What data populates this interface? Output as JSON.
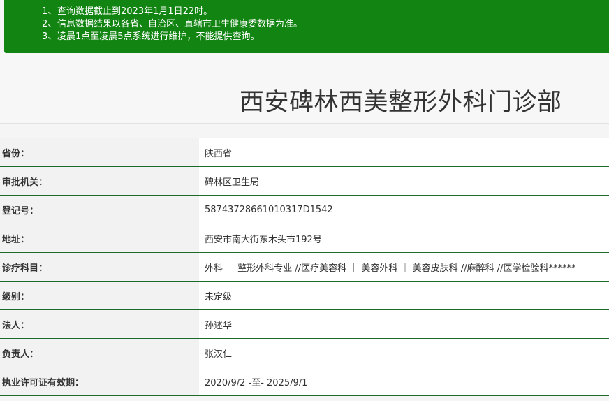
{
  "notice": {
    "lines": [
      {
        "num": "1、",
        "text": "查询数据截止到2023年1月1日22时。"
      },
      {
        "num": "2、",
        "text": "信息数据结果以各省、自治区、直辖市卫生健康委数据为准。"
      },
      {
        "num": "3、",
        "text": "凌晨1点至凌晨5点系统进行维护，不能提供查询。"
      }
    ]
  },
  "page": {
    "title": "西安碑林西美整形外科门诊部"
  },
  "info": {
    "rows": [
      {
        "label": "省份：",
        "value": "陕西省"
      },
      {
        "label": "审批机关：",
        "value": "碑林区卫生局"
      },
      {
        "label": "登记号：",
        "value": "58743728661010317D1542"
      },
      {
        "label": "地址：",
        "value": "西安市南大街东木头市192号"
      },
      {
        "label": "诊疗科目：",
        "value": "外科 ｜ 整形外科专业 //医疗美容科 ｜ 美容外科 ｜ 美容皮肤科 //麻醉科 //医学检验科******"
      },
      {
        "label": "级别：",
        "value": "未定级"
      },
      {
        "label": "法人：",
        "value": "孙述华"
      },
      {
        "label": "负责人：",
        "value": "张汉仁"
      },
      {
        "label": "执业许可证有效期：",
        "value": "2020/9/2 -至- 2025/9/1"
      }
    ]
  },
  "colors": {
    "notice_bg": "#128412",
    "row_border": "#1c6b2a"
  }
}
